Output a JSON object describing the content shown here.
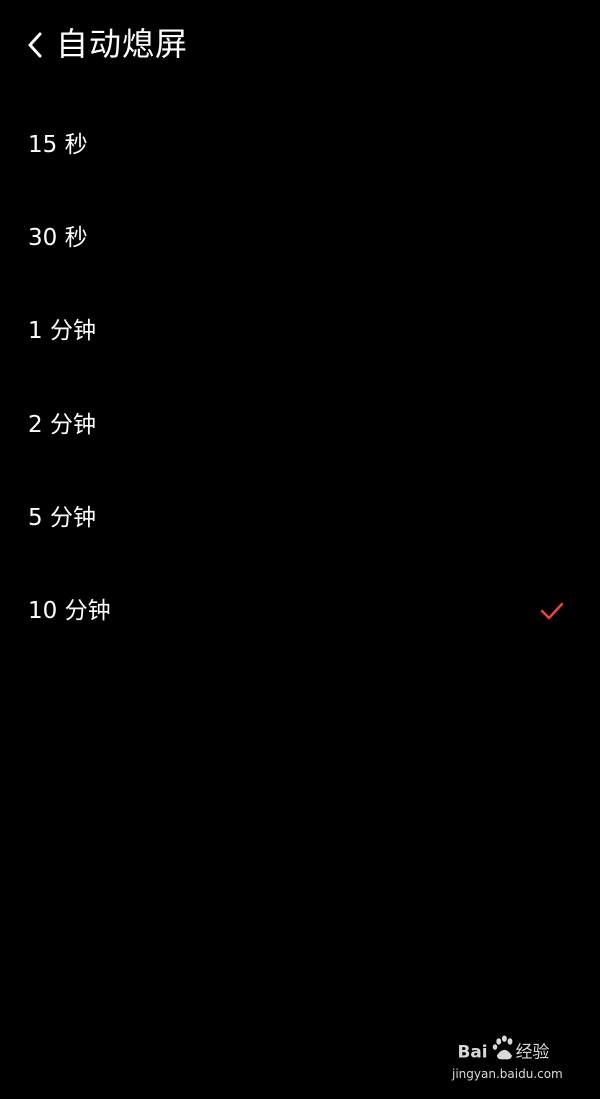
{
  "header": {
    "back_icon": "chevron-left-icon",
    "title": "自动熄屏"
  },
  "options": [
    {
      "label": "15 秒",
      "selected": false
    },
    {
      "label": "30 秒",
      "selected": false
    },
    {
      "label": "1 分钟",
      "selected": false
    },
    {
      "label": "2 分钟",
      "selected": false
    },
    {
      "label": "5 分钟",
      "selected": false
    },
    {
      "label": "10 分钟",
      "selected": true
    }
  ],
  "selection_icon": "checkmark-icon",
  "colors": {
    "background": "#000000",
    "text": "#ffffff",
    "accent": "#e8433f"
  },
  "watermark": {
    "logo_text": "Bai百度经验",
    "url": "jingyan.baidu.com"
  }
}
